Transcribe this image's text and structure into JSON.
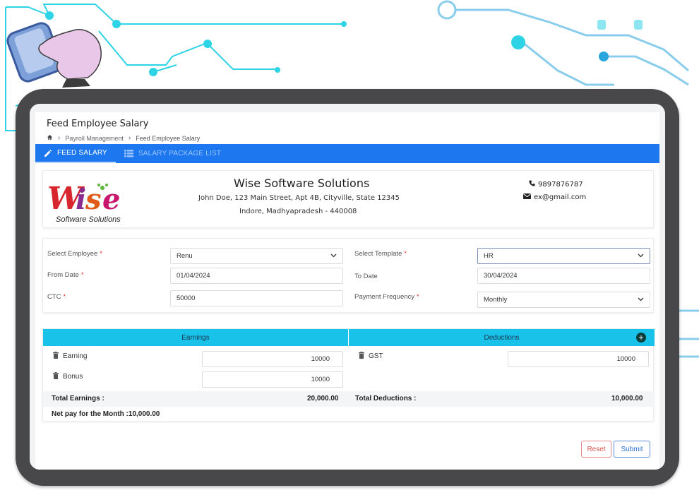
{
  "page": {
    "title": "Feed Employee Salary",
    "breadcrumb": [
      "Payroll Management",
      "Feed Employee Salary"
    ]
  },
  "tabs": [
    {
      "label": "FEED SALARY",
      "icon": "pencil-icon",
      "active": true
    },
    {
      "label": "SALARY PACKAGE LIST",
      "icon": "list-icon",
      "active": false
    }
  ],
  "company": {
    "logo_text": "Wise",
    "logo_tagline": "Software Solutions",
    "name": "Wise Software Solutions",
    "address": "John Doe, 123 Main Street, Apt 4B, Cityville, State 12345",
    "city": "Indore, Madhyapradesh - 440008",
    "phone": "9897876787",
    "email": "ex@gmail.com"
  },
  "form": {
    "employee_label": "Select Employee",
    "employee_value": "Renu",
    "template_label": "Select Template",
    "template_value": "HR",
    "from_date_label": "From Date",
    "from_date_value": "01/04/2024",
    "to_date_label": "To Date",
    "to_date_value": "30/04/2024",
    "ctc_label": "CTC",
    "ctc_value": "50000",
    "frequency_label": "Payment Frequency",
    "frequency_value": "Monthly",
    "required_mark": "*"
  },
  "earnings": {
    "header": "Earnings",
    "rows": [
      {
        "label": "Earning",
        "amount": "10000"
      },
      {
        "label": "Bonus",
        "amount": "10000"
      }
    ],
    "total_label": "Total Earnings :",
    "total_value": "20,000.00"
  },
  "deductions": {
    "header": "Deductions",
    "add_symbol": "+",
    "rows": [
      {
        "label": "GST",
        "amount": "10000"
      }
    ],
    "total_label": "Total Deductions :",
    "total_value": "10,000.00"
  },
  "net_pay": "Net pay for the Month :10,000.00",
  "actions": {
    "reset": "Reset",
    "submit": "Submit"
  },
  "colors": {
    "tab_bar": "#1d78f0",
    "table_header": "#19c2e8",
    "required": "#e53935",
    "reset": "#d9534f",
    "submit": "#2f6fcc",
    "circuit": "#2fd3e6",
    "tablet_frame": "#48484b"
  }
}
